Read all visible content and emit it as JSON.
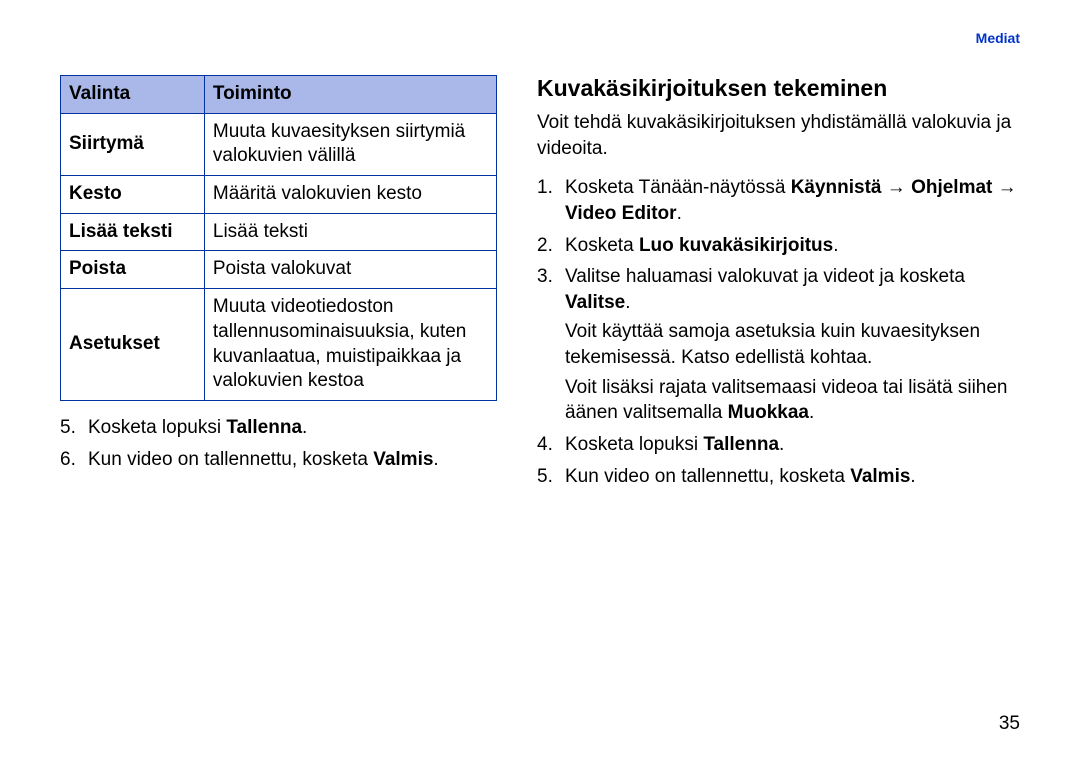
{
  "header": {
    "section": "Mediat"
  },
  "table": {
    "headers": [
      "Valinta",
      "Toiminto"
    ],
    "rows": [
      {
        "label": "Siirtymä",
        "desc": "Muuta kuvaesityksen siirtymiä valokuvien välillä"
      },
      {
        "label": "Kesto",
        "desc": "Määritä valokuvien kesto"
      },
      {
        "label": "Lisää teksti",
        "desc": "Lisää teksti"
      },
      {
        "label": "Poista",
        "desc": "Poista valokuvat"
      },
      {
        "label": "Asetukset",
        "desc": "Muuta videotiedoston tallennusominaisuuksia, kuten kuvanlaatua, muistipaikkaa ja valokuvien kestoa"
      }
    ]
  },
  "left_steps": {
    "s5_a": "Kosketa lopuksi ",
    "s5_b": "Tallenna",
    "s5_c": ".",
    "s6_a": "Kun video on tallennettu, kosketa ",
    "s6_b": "Valmis",
    "s6_c": "."
  },
  "right": {
    "title": "Kuvakäsikirjoituksen tekeminen",
    "intro": "Voit tehdä kuvakäsikirjoituksen yhdistämällä valokuvia ja videoita.",
    "s1_a": "Kosketa Tänään-näytössä ",
    "s1_b": "Käynnistä",
    "s1_arrow": " → ",
    "s1_c": "Ohjelmat",
    "s1_d": "Video Editor",
    "s1_e": ".",
    "s2_a": "Kosketa ",
    "s2_b": "Luo kuvakäsikirjoitus",
    "s2_c": ".",
    "s3_a": "Valitse haluamasi valokuvat ja videot ja kosketa ",
    "s3_b": "Valitse",
    "s3_c": ".",
    "s3_sub1": "Voit käyttää samoja asetuksia kuin kuvaesityksen tekemisessä. Katso edellistä kohtaa.",
    "s3_sub2_a": "Voit lisäksi rajata valitsemaasi videoa tai lisätä siihen äänen valitsemalla ",
    "s3_sub2_b": "Muokkaa",
    "s3_sub2_c": ".",
    "s4_a": "Kosketa lopuksi ",
    "s4_b": "Tallenna",
    "s4_c": ".",
    "s5_a": "Kun video on tallennettu, kosketa ",
    "s5_b": "Valmis",
    "s5_c": "."
  },
  "page": "35"
}
